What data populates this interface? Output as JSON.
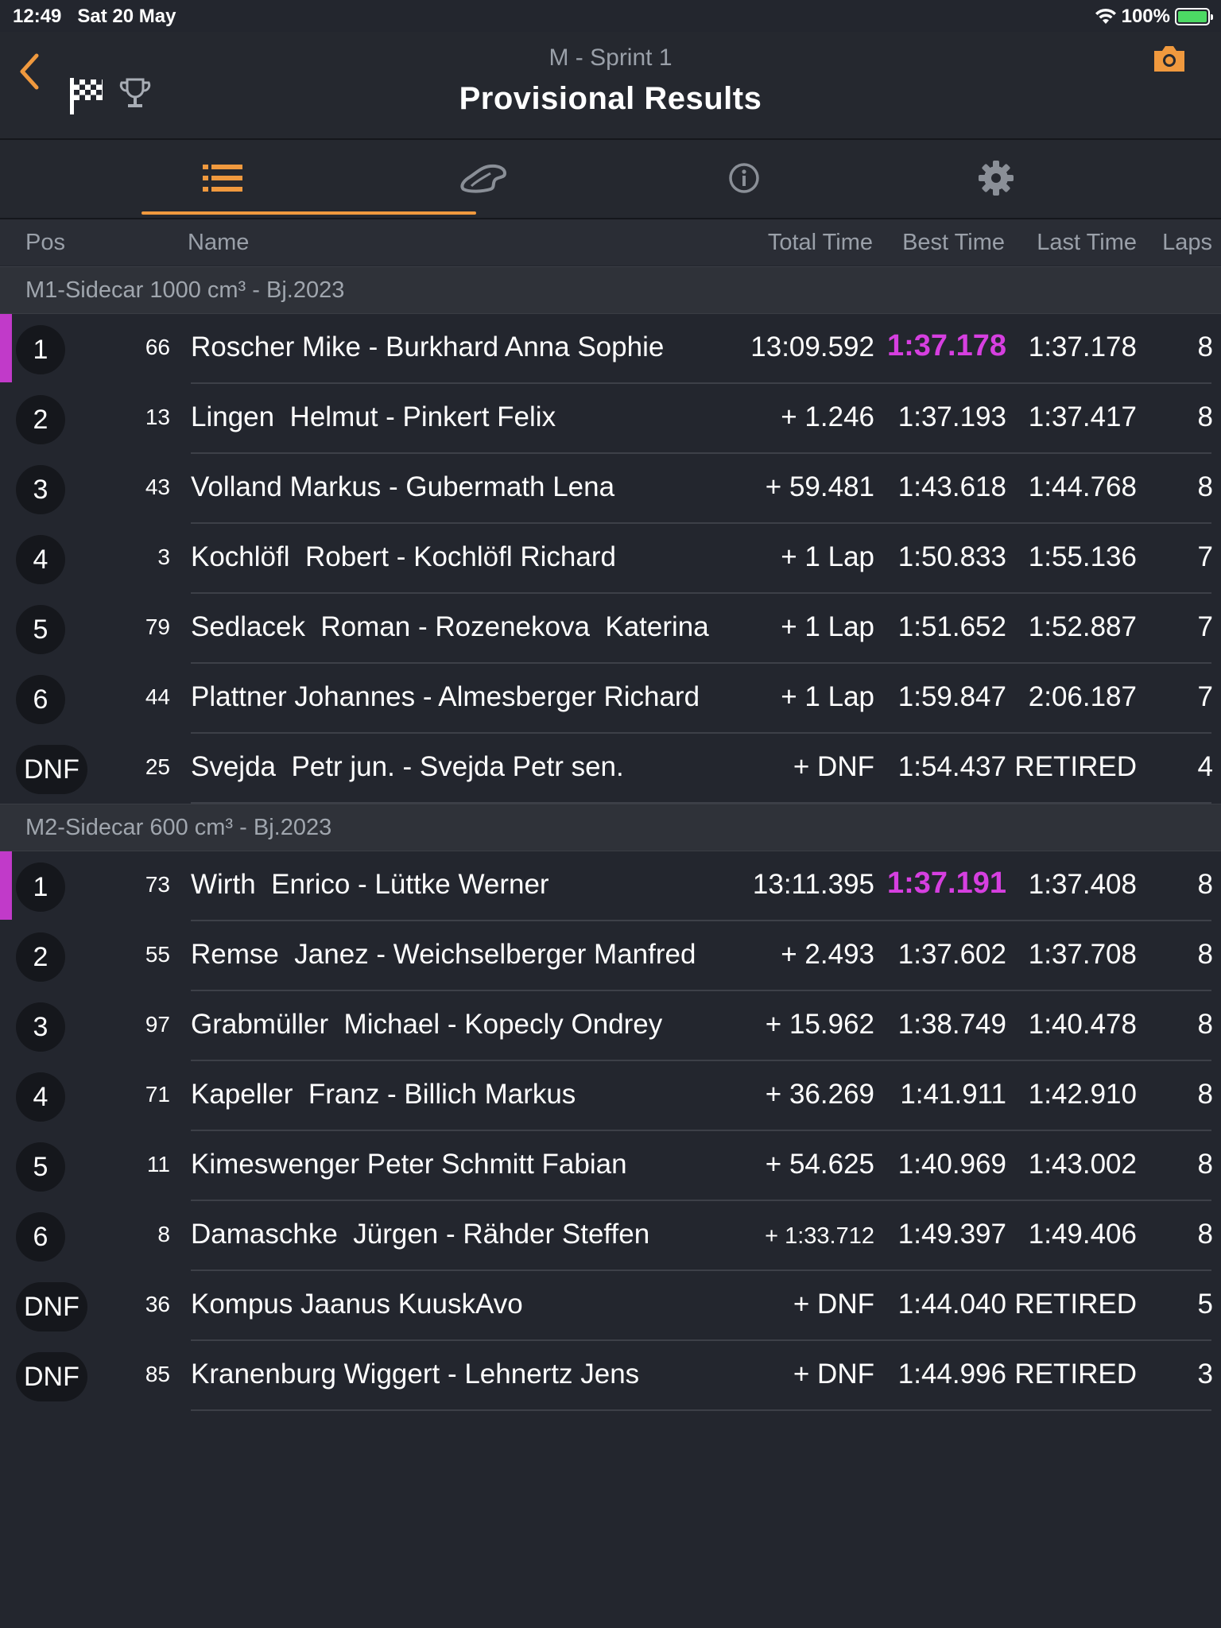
{
  "status": {
    "time": "12:49",
    "date": "Sat 20 May",
    "battery": "100%"
  },
  "header": {
    "subtitle": "M - Sprint 1",
    "title": "Provisional Results"
  },
  "tabs": [
    "list-icon",
    "track-icon",
    "info-icon",
    "settings-icon"
  ],
  "columns": {
    "pos": "Pos",
    "name": "Name",
    "total": "Total Time",
    "best": "Best Time",
    "last": "Last Time",
    "laps": "Laps"
  },
  "colors": {
    "accent": "#f0993e",
    "fastest": "#d63fe0",
    "background": "#23262e"
  },
  "groups": [
    {
      "title": "M1-Sidecar 1000 cm³ - Bj.2023",
      "rows": [
        {
          "pos": "1",
          "num": "66",
          "name": "Roscher Mike - Burkhard Anna Sophie",
          "total": "13:09.592",
          "best": "1:37.178",
          "last": "1:37.178",
          "laps": "8"
        },
        {
          "pos": "2",
          "num": "13",
          "name": "Lingen  Helmut - Pinkert Felix",
          "total": "+ 1.246",
          "best": "1:37.193",
          "last": "1:37.417",
          "laps": "8"
        },
        {
          "pos": "3",
          "num": "43",
          "name": "Volland Markus - Gubermath Lena",
          "total": "+ 59.481",
          "best": "1:43.618",
          "last": "1:44.768",
          "laps": "8"
        },
        {
          "pos": "4",
          "num": "3",
          "name": "Kochlöfl  Robert - Kochlöfl Richard",
          "total": "+ 1 Lap",
          "best": "1:50.833",
          "last": "1:55.136",
          "laps": "7"
        },
        {
          "pos": "5",
          "num": "79",
          "name": "Sedlacek  Roman - Rozenekova  Katerina",
          "total": "+ 1 Lap",
          "best": "1:51.652",
          "last": "1:52.887",
          "laps": "7"
        },
        {
          "pos": "6",
          "num": "44",
          "name": "Plattner Johannes - Almesberger Richard",
          "total": "+ 1 Lap",
          "best": "1:59.847",
          "last": "2:06.187",
          "laps": "7"
        },
        {
          "pos": "DNF",
          "num": "25",
          "name": "Svejda  Petr jun. - Svejda Petr sen.",
          "total": "+ DNF",
          "best": "1:54.437",
          "last": "RETIRED",
          "laps": "4"
        }
      ]
    },
    {
      "title": "M2-Sidecar 600 cm³ - Bj.2023",
      "rows": [
        {
          "pos": "1",
          "num": "73",
          "name": "Wirth  Enrico - Lüttke Werner",
          "total": "13:11.395",
          "best": "1:37.191",
          "last": "1:37.408",
          "laps": "8"
        },
        {
          "pos": "2",
          "num": "55",
          "name": "Remse  Janez - Weichselberger Manfred",
          "total": "+ 2.493",
          "best": "1:37.602",
          "last": "1:37.708",
          "laps": "8"
        },
        {
          "pos": "3",
          "num": "97",
          "name": "Grabmüller  Michael - Kopecly Ondrey",
          "total": "+ 15.962",
          "best": "1:38.749",
          "last": "1:40.478",
          "laps": "8"
        },
        {
          "pos": "4",
          "num": "71",
          "name": "Kapeller  Franz - Billich Markus",
          "total": "+ 36.269",
          "best": "1:41.911",
          "last": "1:42.910",
          "laps": "8"
        },
        {
          "pos": "5",
          "num": "11",
          "name": "Kimeswenger Peter Schmitt Fabian",
          "total": "+ 54.625",
          "best": "1:40.969",
          "last": "1:43.002",
          "laps": "8"
        },
        {
          "pos": "6",
          "num": "8",
          "name": "Damaschke  Jürgen - Rähder Steffen",
          "total": "+ 1:33.712",
          "best": "1:49.397",
          "last": "1:49.406",
          "laps": "8"
        },
        {
          "pos": "DNF",
          "num": "36",
          "name": "Kompus Jaanus KuuskAvo",
          "total": "+ DNF",
          "best": "1:44.040",
          "last": "RETIRED",
          "laps": "5"
        },
        {
          "pos": "DNF",
          "num": "85",
          "name": "Kranenburg Wiggert - Lehnertz Jens",
          "total": "+ DNF",
          "best": "1:44.996",
          "last": "RETIRED",
          "laps": "3"
        }
      ]
    }
  ]
}
